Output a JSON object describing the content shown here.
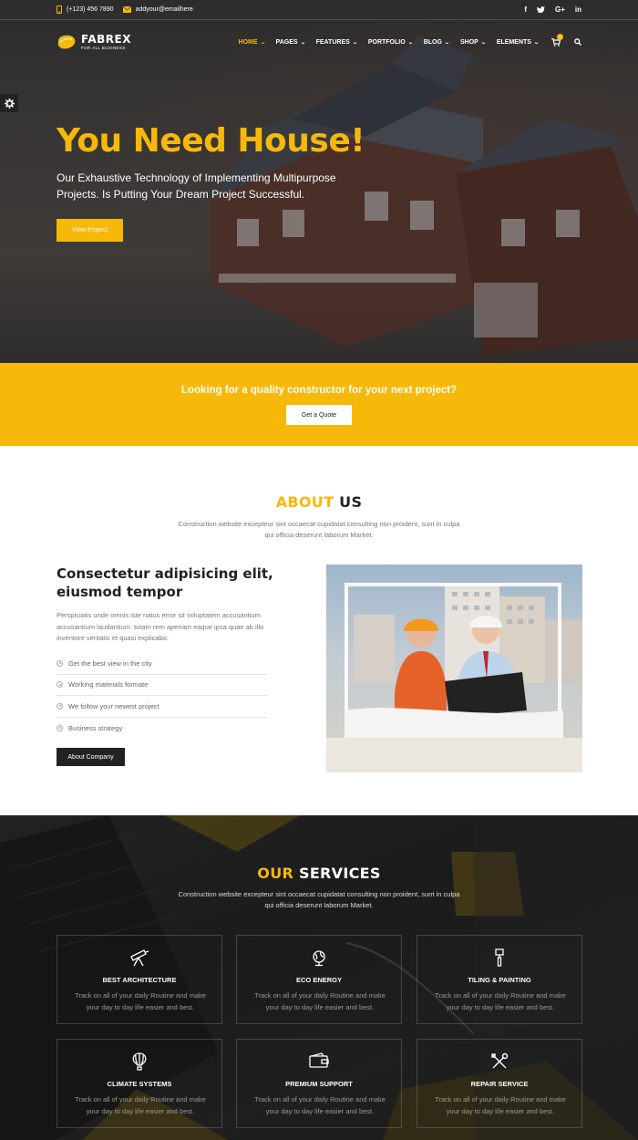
{
  "topbar": {
    "phone": "(+123) 456 7890",
    "email": "addyour@emailhere",
    "socials": [
      "f",
      "t",
      "G+",
      "in"
    ]
  },
  "brand": {
    "name": "FABREX",
    "tagline": "FOR ALL BUSINESS",
    "accent": "#f7b80a"
  },
  "nav": {
    "items": [
      {
        "label": "HOME",
        "active": true
      },
      {
        "label": "PAGES"
      },
      {
        "label": "FEATURES"
      },
      {
        "label": "PORTFOLIO"
      },
      {
        "label": "BLOG"
      },
      {
        "label": "SHOP"
      },
      {
        "label": "ELEMENTS"
      }
    ],
    "cart_count": "0"
  },
  "hero": {
    "title": "You Need House!",
    "text": "Our Exhaustive Technology of Implementing Multipurpose Projects. Is Putting Your Dream Project Successful.",
    "button": "View Project"
  },
  "cta": {
    "text": "Looking for a quality constructor for your next project?",
    "button": "Get a Quote"
  },
  "about": {
    "title_hl": "ABOUT",
    "title_rest": " US",
    "subtitle": "Construction website excepteur sint occaecat cupidatat consulting non proident, sunt in culpa qui officia deserunt laborum Market.",
    "heading": "Consectetur adipisicing elit, eiusmod tempor",
    "paragraph": "Perspiciatis unde omnis iste natus error sit voluptatem accusantium accusantium laudantium. totam rem aperiam eaque ipsa quae ab illo inventore veritatis et quasi explicabo.",
    "list": [
      "Get the best view in the city",
      "Working materials formate",
      "We follow your newest project",
      "Business strategy"
    ],
    "button": "About Company"
  },
  "services": {
    "title_hl": "OUR",
    "title_rest": " SERVICES",
    "subtitle": "Construction website excepteur sint occaecat cupidatat consulting non proident, sunt in culpa qui officia deserunt laborum Market.",
    "cards": [
      {
        "title": "BEST ARCHITECTURE",
        "text": "Track on all of your daily Routine and make your day to day life easier and best.",
        "icon": "telescope-icon"
      },
      {
        "title": "ECO ENERGY",
        "text": "Track on all of your daily Routine and make your day to day life easier and best.",
        "icon": "globe-icon"
      },
      {
        "title": "TILING & PAINTING",
        "text": "Track on all of your daily Routine and make your day to day life easier and best.",
        "icon": "paint-roller-icon"
      },
      {
        "title": "CLIMATE SYSTEMS",
        "text": "Track on all of your daily Routine and make your day to day life easier and best.",
        "icon": "air-balloon-icon"
      },
      {
        "title": "PREMIUM SUPPORT",
        "text": "Track on all of your daily Routine and make your day to day life easier and best.",
        "icon": "wallet-icon"
      },
      {
        "title": "REPAIR SERVICE",
        "text": "Track on all of your daily Routine and make your day to day life easier and best.",
        "icon": "tools-icon"
      }
    ]
  }
}
